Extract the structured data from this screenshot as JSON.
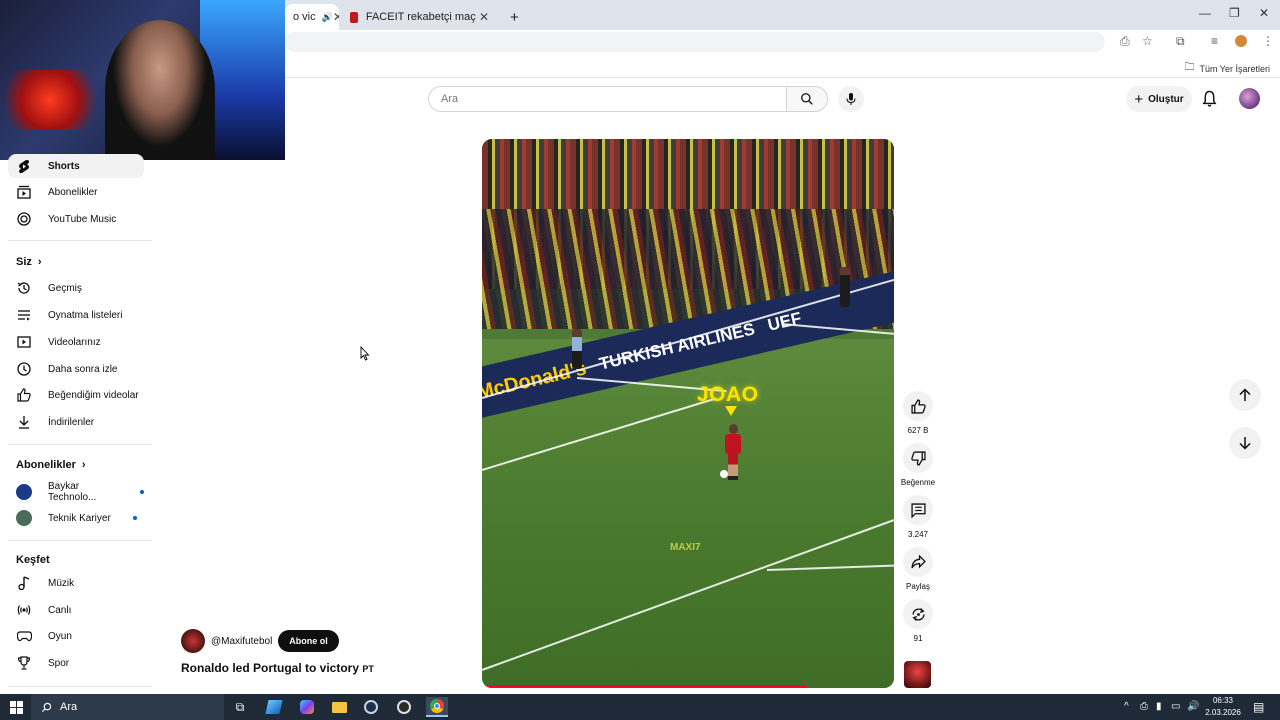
{
  "browser": {
    "tabs": [
      {
        "label": "o vic",
        "active": true
      },
      {
        "label": "FACEIT rekabetçi maç - FACEIT",
        "active": false
      }
    ],
    "bookmarks_label": "Tüm Yer İşaretleri"
  },
  "header": {
    "search_placeholder": "Ara",
    "create_label": "Oluştur"
  },
  "sidebar": {
    "top_items": [
      {
        "label": "Shorts",
        "icon": "shorts-icon",
        "active": true
      },
      {
        "label": "Abonelikler",
        "icon": "subscriptions-icon"
      },
      {
        "label": "YouTube Music",
        "icon": "youtube-music-icon"
      }
    ],
    "you_heading": "Siz",
    "you_items": [
      {
        "label": "Geçmiş",
        "icon": "history-icon"
      },
      {
        "label": "Oynatma listeleri",
        "icon": "playlists-icon"
      },
      {
        "label": "Videolarınız",
        "icon": "your-videos-icon"
      },
      {
        "label": "Daha sonra izle",
        "icon": "watch-later-icon"
      },
      {
        "label": "Beğendiğim videolar",
        "icon": "liked-videos-icon"
      },
      {
        "label": "İndirilenler",
        "icon": "downloads-icon"
      }
    ],
    "subs_heading": "Abonelikler",
    "subs_items": [
      {
        "label": "Baykar Technolo...",
        "color": "#1a3a8a"
      },
      {
        "label": "Teknik Kariyer",
        "color": "#4a6a5a"
      }
    ],
    "explore_heading": "Keşfet",
    "explore_items": [
      {
        "label": "Müzik",
        "icon": "music-icon"
      },
      {
        "label": "Canlı",
        "icon": "live-icon"
      },
      {
        "label": "Oyun",
        "icon": "gaming-icon"
      },
      {
        "label": "Spor",
        "icon": "sports-icon"
      }
    ]
  },
  "short": {
    "player_label": "JOAO",
    "watermark": "MAXI7",
    "ad_board_brand1": "McDonald's",
    "ad_board_brand2": "TURKISH AIRLINES",
    "ad_board_brand3": "UEF",
    "channel": "@Maxifutebol",
    "subscribe_label": "Abone ol",
    "title": "Ronaldo led Portugal to victory",
    "title_tag": "PT",
    "progress": 0.79
  },
  "actions": {
    "likes": "627 B",
    "dislike_label": "Beğenme",
    "comments": "3.247",
    "share_label": "Paylaş",
    "remix_count": "91"
  },
  "taskbar": {
    "search_label": "Ara",
    "time": "06:33",
    "date": "2.03.2026"
  },
  "colors": {
    "accent": "#ff0033",
    "subscribe_bg": "#0f0f0f",
    "taskbar_bg": "#1f2a38"
  }
}
